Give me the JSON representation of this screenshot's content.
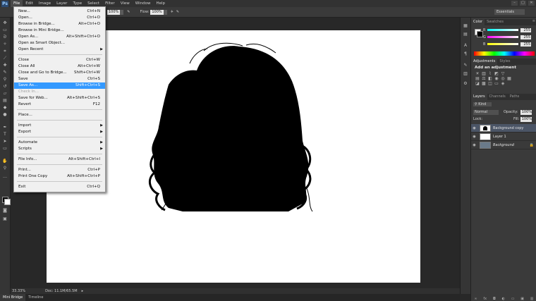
{
  "app": {
    "logo": "Ps"
  },
  "menubar": {
    "items": [
      "File",
      "Edit",
      "Image",
      "Layer",
      "Type",
      "Select",
      "Filter",
      "View",
      "Window",
      "Help"
    ],
    "window_controls": [
      "–",
      "□",
      "✕"
    ]
  },
  "options": {
    "zoom1": "100%",
    "flow_label": "Flow:",
    "flow": "100%",
    "workspace": "Essentials"
  },
  "file_menu": {
    "new": {
      "label": "New...",
      "shortcut": "Ctrl+N"
    },
    "open": {
      "label": "Open...",
      "shortcut": "Ctrl+O"
    },
    "browse_bridge": {
      "label": "Browse in Bridge...",
      "shortcut": "Alt+Ctrl+O"
    },
    "browse_mini": {
      "label": "Browse in Mini Bridge...",
      "shortcut": ""
    },
    "open_as": {
      "label": "Open As...",
      "shortcut": "Alt+Shift+Ctrl+O"
    },
    "open_smart": {
      "label": "Open as Smart Object...",
      "shortcut": ""
    },
    "open_recent": {
      "label": "Open Recent",
      "shortcut": ""
    },
    "close": {
      "label": "Close",
      "shortcut": "Ctrl+W"
    },
    "close_all": {
      "label": "Close All",
      "shortcut": "Alt+Ctrl+W"
    },
    "close_bridge": {
      "label": "Close and Go to Bridge...",
      "shortcut": "Shift+Ctrl+W"
    },
    "save": {
      "label": "Save",
      "shortcut": "Ctrl+S"
    },
    "save_as": {
      "label": "Save As...",
      "shortcut": "Shift+Ctrl+S"
    },
    "check_in": {
      "label": "Check In...",
      "shortcut": ""
    },
    "save_web": {
      "label": "Save for Web...",
      "shortcut": "Alt+Shift+Ctrl+S"
    },
    "revert": {
      "label": "Revert",
      "shortcut": "F12"
    },
    "place": {
      "label": "Place...",
      "shortcut": ""
    },
    "import": {
      "label": "Import",
      "shortcut": ""
    },
    "export": {
      "label": "Export",
      "shortcut": ""
    },
    "automate": {
      "label": "Automate",
      "shortcut": ""
    },
    "scripts": {
      "label": "Scripts",
      "shortcut": ""
    },
    "file_info": {
      "label": "File Info...",
      "shortcut": "Alt+Shift+Ctrl+I"
    },
    "print": {
      "label": "Print...",
      "shortcut": "Ctrl+P"
    },
    "print_one": {
      "label": "Print One Copy",
      "shortcut": "Alt+Shift+Ctrl+P"
    },
    "exit": {
      "label": "Exit",
      "shortcut": "Ctrl+Q"
    },
    "highlight_color": "#3399ff"
  },
  "color_panel": {
    "tabs": [
      "Color",
      "Swatches"
    ],
    "r": {
      "label": "R",
      "value": "255"
    },
    "g": {
      "label": "G",
      "value": "255"
    },
    "b": {
      "label": "B",
      "value": "255"
    }
  },
  "adjustments_panel": {
    "tabs": [
      "Adjustments",
      "Styles"
    ],
    "heading": "Add an adjustment"
  },
  "layers_panel": {
    "tabs": [
      "Layers",
      "Channels",
      "Paths"
    ],
    "kind": "Kind",
    "blend_mode": "Normal",
    "opacity_label": "Opacity:",
    "opacity": "100%",
    "lock_label": "Lock:",
    "fill_label": "Fill:",
    "fill": "100%",
    "layers": [
      {
        "name": "Background copy",
        "selected": true
      },
      {
        "name": "Layer 1",
        "selected": false
      },
      {
        "name": "Background",
        "selected": false
      }
    ]
  },
  "status": {
    "zoom": "33.33%",
    "doc": "Doc: 11.1M/65.5M"
  },
  "bottom_tabs": [
    "Mini Bridge",
    "Timeline"
  ]
}
